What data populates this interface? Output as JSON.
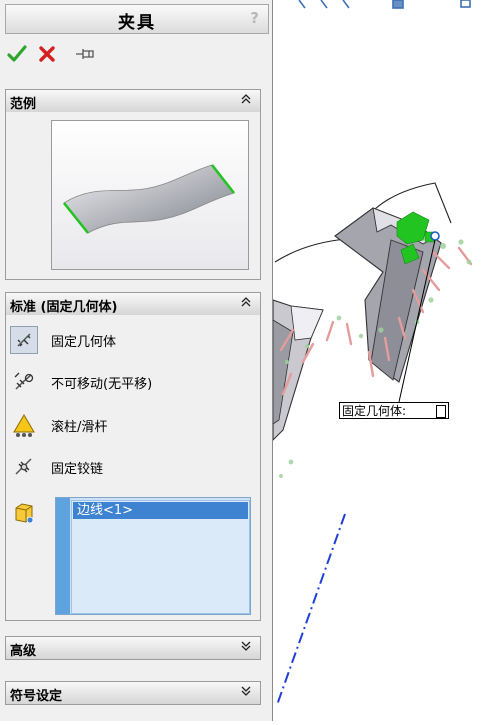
{
  "panel": {
    "title": "夹具",
    "help": "?",
    "actions": {
      "ok_icon": "checkmark-icon",
      "cancel_icon": "x-icon",
      "pin_icon": "pushpin-icon"
    }
  },
  "sections": {
    "example": {
      "label": "范例",
      "chevron": "≈"
    },
    "standard": {
      "label": "标准 (固定几何体)",
      "chevron": "≈",
      "options": [
        {
          "label": "固定几何体",
          "icon": "fixed-geometry-icon",
          "selected": true
        },
        {
          "label": "不可移动(无平移)",
          "icon": "immovable-icon",
          "selected": false
        },
        {
          "label": "滚柱/滑杆",
          "icon": "roller-slider-icon",
          "selected": false
        },
        {
          "label": "固定铰链",
          "icon": "fixed-hinge-icon",
          "selected": false
        }
      ],
      "selection_item": "边线<1>"
    },
    "advanced": {
      "label": "高级",
      "chevron": "≚"
    },
    "symbol": {
      "label": "符号设定",
      "chevron": "≚"
    }
  },
  "canvas": {
    "callout": "固定几何体:"
  },
  "colors": {
    "accent_blue": "#3d83d2",
    "list_bg": "#dbeaf8",
    "fixture_green": "#22c422",
    "arrow_red": "#e89a9a"
  }
}
